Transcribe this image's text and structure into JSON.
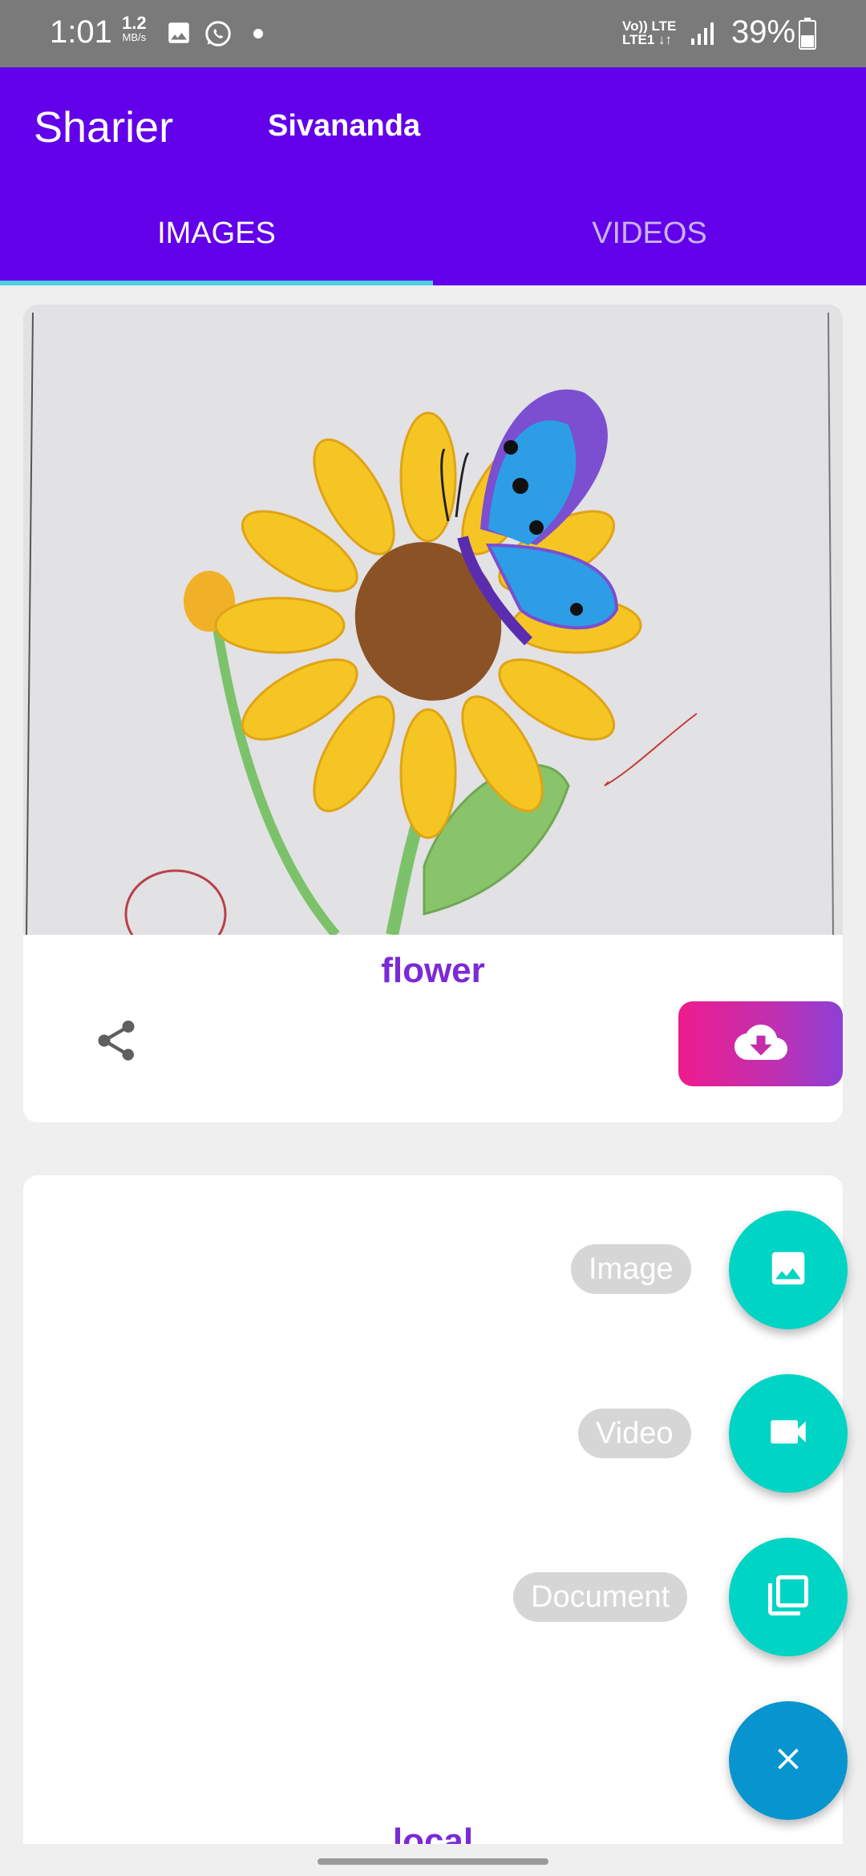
{
  "status_bar": {
    "time": "1:01",
    "speed_value": "1.2",
    "speed_unit": "MB/s",
    "network": "Vo)) LTE\nLTE1 ↓↑",
    "battery": "39%",
    "icons": [
      "gallery-icon",
      "whatsapp-icon",
      "signal-icon",
      "battery-icon"
    ]
  },
  "app_bar": {
    "title": "Sharier",
    "user": "Sivananda",
    "tabs": [
      {
        "label": "IMAGES",
        "active": true
      },
      {
        "label": "VIDEOS",
        "active": false
      }
    ],
    "color": "#6200ea",
    "indicator_color": "#4dd0e1"
  },
  "cards": [
    {
      "caption": "flower",
      "image": "sunflower-butterfly-drawing",
      "actions": [
        "share-icon",
        "cloud-download-icon"
      ]
    },
    {
      "caption": "local"
    }
  ],
  "fab_menu": {
    "items": [
      {
        "label": "Image",
        "icon": "image-icon"
      },
      {
        "label": "Video",
        "icon": "videocam-icon"
      },
      {
        "label": "Document",
        "icon": "library-icon"
      }
    ],
    "main_icon": "close-icon",
    "item_color": "#00d4c4",
    "main_color": "#0895cf"
  }
}
